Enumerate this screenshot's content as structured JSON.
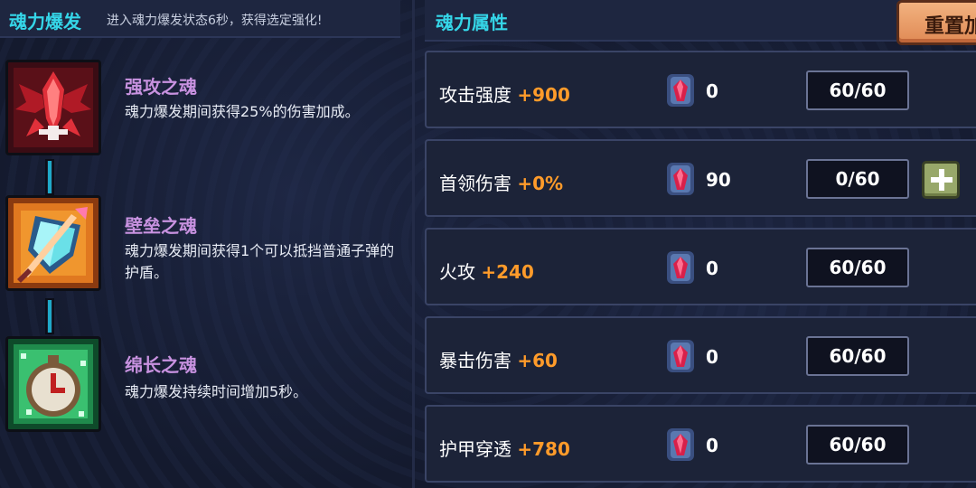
{
  "left_panel": {
    "title": "魂力爆发",
    "description": "进入魂力爆发状态6秒，获得选定强化!",
    "skills": [
      {
        "name": "强攻之魂",
        "description": "魂力爆发期间获得25%的伤害加成。",
        "icon": "red-phoenix-icon"
      },
      {
        "name": "壁垒之魂",
        "description": "魂力爆发期间获得1个可以抵挡普通子弹的护盾。",
        "icon": "shield-sword-icon"
      },
      {
        "name": "绵长之魂",
        "description": "魂力爆发持续时间增加5秒。",
        "icon": "stopwatch-icon"
      }
    ]
  },
  "right_panel": {
    "title": "魂力属性",
    "reset_label": "重置加",
    "attributes": [
      {
        "label": "攻击强度",
        "bonus": "+900",
        "gem_count": "0",
        "level": "60/60",
        "can_add": false
      },
      {
        "label": "首领伤害",
        "bonus": "+0%",
        "gem_count": "90",
        "level": "0/60",
        "can_add": true
      },
      {
        "label": "火攻",
        "bonus": "+240",
        "gem_count": "0",
        "level": "60/60",
        "can_add": false
      },
      {
        "label": "暴击伤害",
        "bonus": "+60",
        "gem_count": "0",
        "level": "60/60",
        "can_add": false
      },
      {
        "label": "护甲穿透",
        "bonus": "+780",
        "gem_count": "0",
        "level": "60/60",
        "can_add": false
      }
    ]
  },
  "colors": {
    "title_cyan": "#35d6e8",
    "skill_name_purple": "#c892e0",
    "bonus_orange": "#ff9b2a",
    "reset_button": "#e08a55",
    "plus_button": "#98a86a",
    "background": "#141a2e"
  }
}
